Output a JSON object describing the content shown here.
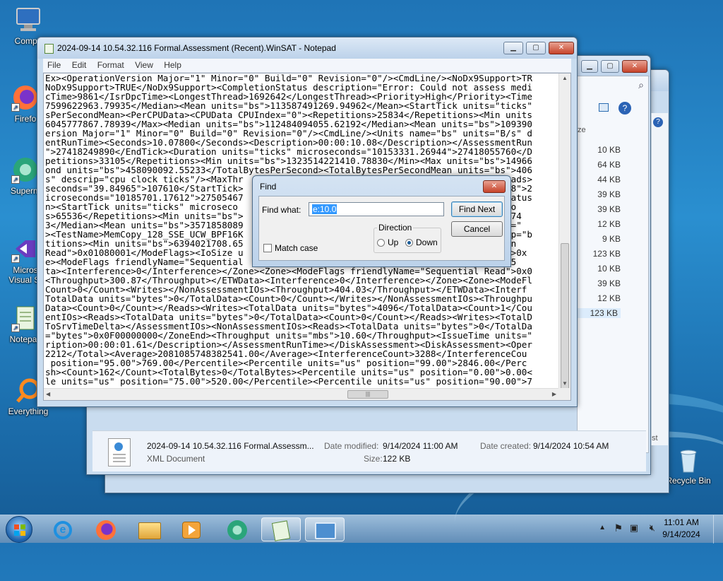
{
  "desktop": {
    "icons": [
      {
        "label": "Compu",
        "icon": "computer-icon"
      },
      {
        "label": "Firefo",
        "icon": "firefox-icon"
      },
      {
        "label": "Superm",
        "icon": "supermium-icon"
      },
      {
        "label": "Micros\nVisual St",
        "icon": "visual-studio-icon"
      },
      {
        "label": "Notepac",
        "icon": "notepad-icon"
      },
      {
        "label": "Everything",
        "icon": "everything-icon"
      },
      {
        "label": "Recycle Bin",
        "icon": "recycle-bin-icon"
      }
    ]
  },
  "notepad": {
    "title": "2024-09-14 10.54.32.116 Formal.Assessment (Recent).WinSAT - Notepad",
    "menu": [
      "File",
      "Edit",
      "Format",
      "View",
      "Help"
    ],
    "lines": [
      "Ex><OperationVersion Major=\"1\" Minor=\"0\" Build=\"0\" Revision=\"0\"/><CmdLine/><NoDx9Support>TR",
      "NoDx9Support>TRUE</NoDx9Support><CompletionStatus description=\"Error: Could not assess medi",
      "cTime>9861</IsrDpcTime><LongestThread>1692642</LongestThread><Priority>High</Priority><Time",
      "7599622963.79935</Median><Mean units=\"bs\">113587491269.94962</Mean><StartTick units=\"ticks\"",
      "sPerSecondMean><PerCPUData><CPUData CPUIndex=\"0\"><Repetitions>25834</Repetitions><Min units",
      "6045777867.78939</Max><Median units=\"bs\">112484094055.62192</Median><Mean units=\"bs\">109390",
      "ersion Major=\"1\" Minor=\"0\" Build=\"0\" Revision=\"0\"/><CmdLine/><Units name=\"bs\" units=\"B/s\" d",
      "entRunTime><Seconds>10.07800</Seconds><Description>00:00:10.08</Description></AssessmentRun",
      "\">27418249890</EndTick><Duration units=\"ticks\" microseconds=\"10153331.26944\">27418055760</D",
      "petitions>33105</Repetitions><Min units=\"bs\">1323514221410.78830</Min><Max units=\"bs\">14966",
      "ond units=\"bs\">458090092.55233</TotalBytesPerSecond><TotalBytesPerSecondMean units=\"bs\">406",
      "s\" descrip=\"cpu clock ticks\"/><MaxThr                                              Threads>",
      "seconds=\"39.84965\">107610</StartTick>                                              38328\">2",
      "icroseconds=\"10185701.17612\">27505467                                              onStatus",
      "n><StartTick units=\"ticks\" microseco                                            s\" micro",
      "s>65536</Repetitions><Min units=\"bs\">                                            07818.74",
      "3</Median><Mean units=\"bs\">3571858089                                            econds=\"",
      "><TestName>MemCopy_128_SSE_UCW_BPF16K                                             escrip=\"b",
      "titions><Min units=\"bs\">6394021708.65                                             Median",
      "Read\">0x01080001</ModeFlags><IoSize u                                             ytes\">0x",
      "e><ModeFlags friendlyName=\"Sequential                                             s\">655",
      "ta><Interference>0</Interference></Zone><Zone><ModeFlags friendlyName=\"Sequential Read\">0x0",
      "<Throughput>300.87</Throughput></ETWData><Interference>0</Interference></Zone><Zone><ModeFl",
      "Count>0</Count><Writes></NonAssessmentIOs><Throughput>404.03</Throughput></ETWData><Interf",
      "TotalData units=\"bytes\">0</TotalData><Count>0</Count></Writes></NonAssessmentIOs><Throughpu",
      "Data><Count>0</Count></Reads><Writes><TotalData units=\"bytes\">4096</TotalData><Count>1</Cou",
      "entIOs><Reads><TotalData units=\"bytes\">0</TotalData><Count>0</Count></Reads><Writes><TotalD",
      "ToSrvTimeDelta></AssessmentIOs><NonAssessmentIOs><Reads><TotalData units=\"bytes\">0</TotalDa",
      "=\"bytes\">0x0F00000000</ZoneEnd><Throughput units=\"mbs\">10.60</Throughput><IssueTime units=\"",
      "ription>00:00:01.61</Description></AssessmentRunTime></DiskAssessment><DiskAssessment><Oper",
      "2212</Total><Average>2081085748382541.00</Average><InterferenceCount>3288</InterferenceCou",
      " position=\"95.00\">769.00</Percentile><Percentile units=\"us\" position=\"99.00\">2846.00</Perc",
      "sh><Count>162</Count><TotalBytes>0</TotalBytes><Percentile units=\"us\" position=\"0.00\">0.00<",
      "le units=\"us\" position=\"75.00\">520.00</Percentile><Percentile units=\"us\" position=\"90.00\">7"
    ]
  },
  "explorer": {
    "column_header": "ze",
    "sizes": [
      "10 KB",
      "64 KB",
      "44 KB",
      "39 KB",
      "39 KB",
      "12 KB",
      "9 KB",
      "123 KB",
      "10 KB",
      "39 KB",
      "12 KB",
      "123 KB"
    ],
    "details": {
      "filename": "2024-09-14 10.54.32.116 Formal.Assessm...",
      "type": "XML Document",
      "date_modified_label": "Date modified:",
      "date_modified": "9/14/2024 11:00 AM",
      "date_created_label": "Date created:",
      "date_created": "9/14/2024 10:54 AM",
      "size_label": "Size:",
      "size": "122 KB",
      "right_fragment": "st"
    }
  },
  "find_dialog": {
    "title": "Find",
    "find_what_label": "Find what:",
    "find_what_value": "e:10.0",
    "find_next_label": "Find Next",
    "cancel_label": "Cancel",
    "direction_label": "Direction",
    "up_label": "Up",
    "down_label": "Down",
    "direction_selected": "Down",
    "match_case_label": "Match case",
    "match_case_checked": false
  },
  "taskbar": {
    "items": [
      "start-orb",
      "internet-explorer-icon",
      "firefox-icon",
      "file-explorer-icon",
      "media-player-icon",
      "supermium-icon",
      "notepad-icon",
      "winsat-icon"
    ],
    "active_index": 7,
    "time": "11:01 AM",
    "date": "9/14/2024"
  },
  "colors": {
    "selection": "#3399ff",
    "desktop": "#1f74b6"
  }
}
